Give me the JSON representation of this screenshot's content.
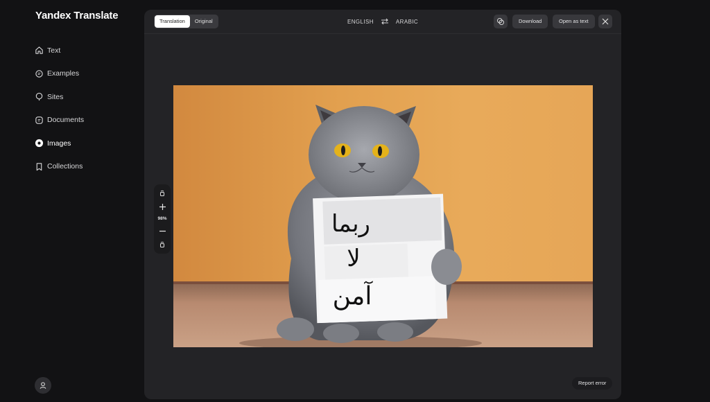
{
  "app": {
    "title": "Yandex Translate"
  },
  "sidebar": {
    "items": [
      {
        "label": "Text",
        "icon": "home-icon"
      },
      {
        "label": "Examples",
        "icon": "chat-icon"
      },
      {
        "label": "Sites",
        "icon": "globe-pin-icon"
      },
      {
        "label": "Documents",
        "icon": "document-icon"
      },
      {
        "label": "Images",
        "icon": "camera-icon",
        "active": true
      },
      {
        "label": "Collections",
        "icon": "bookmark-icon"
      }
    ]
  },
  "toolbar": {
    "tab_translation": "Translation",
    "tab_original": "Original",
    "source_lang": "ENGLISH",
    "target_lang": "ARABIC",
    "download_label": "Download",
    "open_as_text_label": "Open as text"
  },
  "zoom": {
    "value": "98%"
  },
  "sign": {
    "line1": "ربما",
    "line2": "لا",
    "line3": "آمن"
  },
  "footer": {
    "report_label": "Report error"
  },
  "colors": {
    "background": "#121214",
    "panel": "#232326",
    "wall": "#e2a04f",
    "cat": "#7d7f86"
  }
}
